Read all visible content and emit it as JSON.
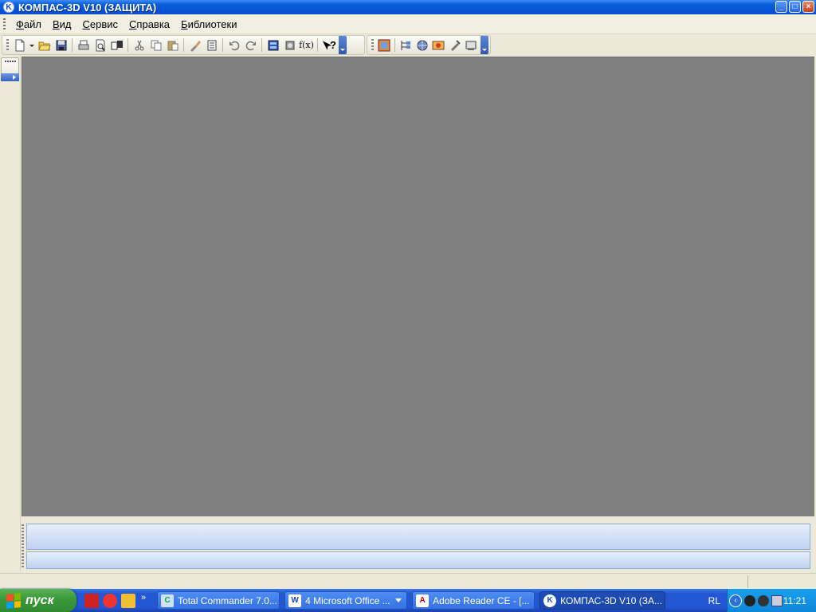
{
  "window": {
    "title": "КОМПАС-3D V10 (ЗАЩИТА)",
    "controls": {
      "minimize": "_",
      "maximize": "□",
      "close": "×"
    }
  },
  "menu": {
    "items": [
      {
        "label": "Файл",
        "mnemonic": "Ф",
        "rest": "айл"
      },
      {
        "label": "Вид",
        "mnemonic": "В",
        "rest": "ид"
      },
      {
        "label": "Сервис",
        "mnemonic": "С",
        "rest": "ервис"
      },
      {
        "label": "Справка",
        "mnemonic": "С",
        "rest": "правка"
      },
      {
        "label": "Библиотеки",
        "mnemonic": "Б",
        "rest": "иблиотеки"
      }
    ]
  },
  "toolbar": {
    "formula_label": "f(x)",
    "help_label": "?"
  },
  "taskbar": {
    "start_label": "пуск",
    "quick_more": "»",
    "tasks": [
      {
        "label": "Total Commander 7.0..."
      },
      {
        "label": "4 Microsoft Office ..."
      },
      {
        "label": "Adobe Reader CE - [..."
      },
      {
        "label": "КОМПАС-3D V10 (ЗА..."
      }
    ],
    "language": "RL",
    "clock": "11:21"
  },
  "colors": {
    "workspace": "#808080",
    "titlebar": "#0453d6",
    "taskbar": "#2457d3",
    "start": "#3c9a3a",
    "tray": "#0e86d9"
  }
}
